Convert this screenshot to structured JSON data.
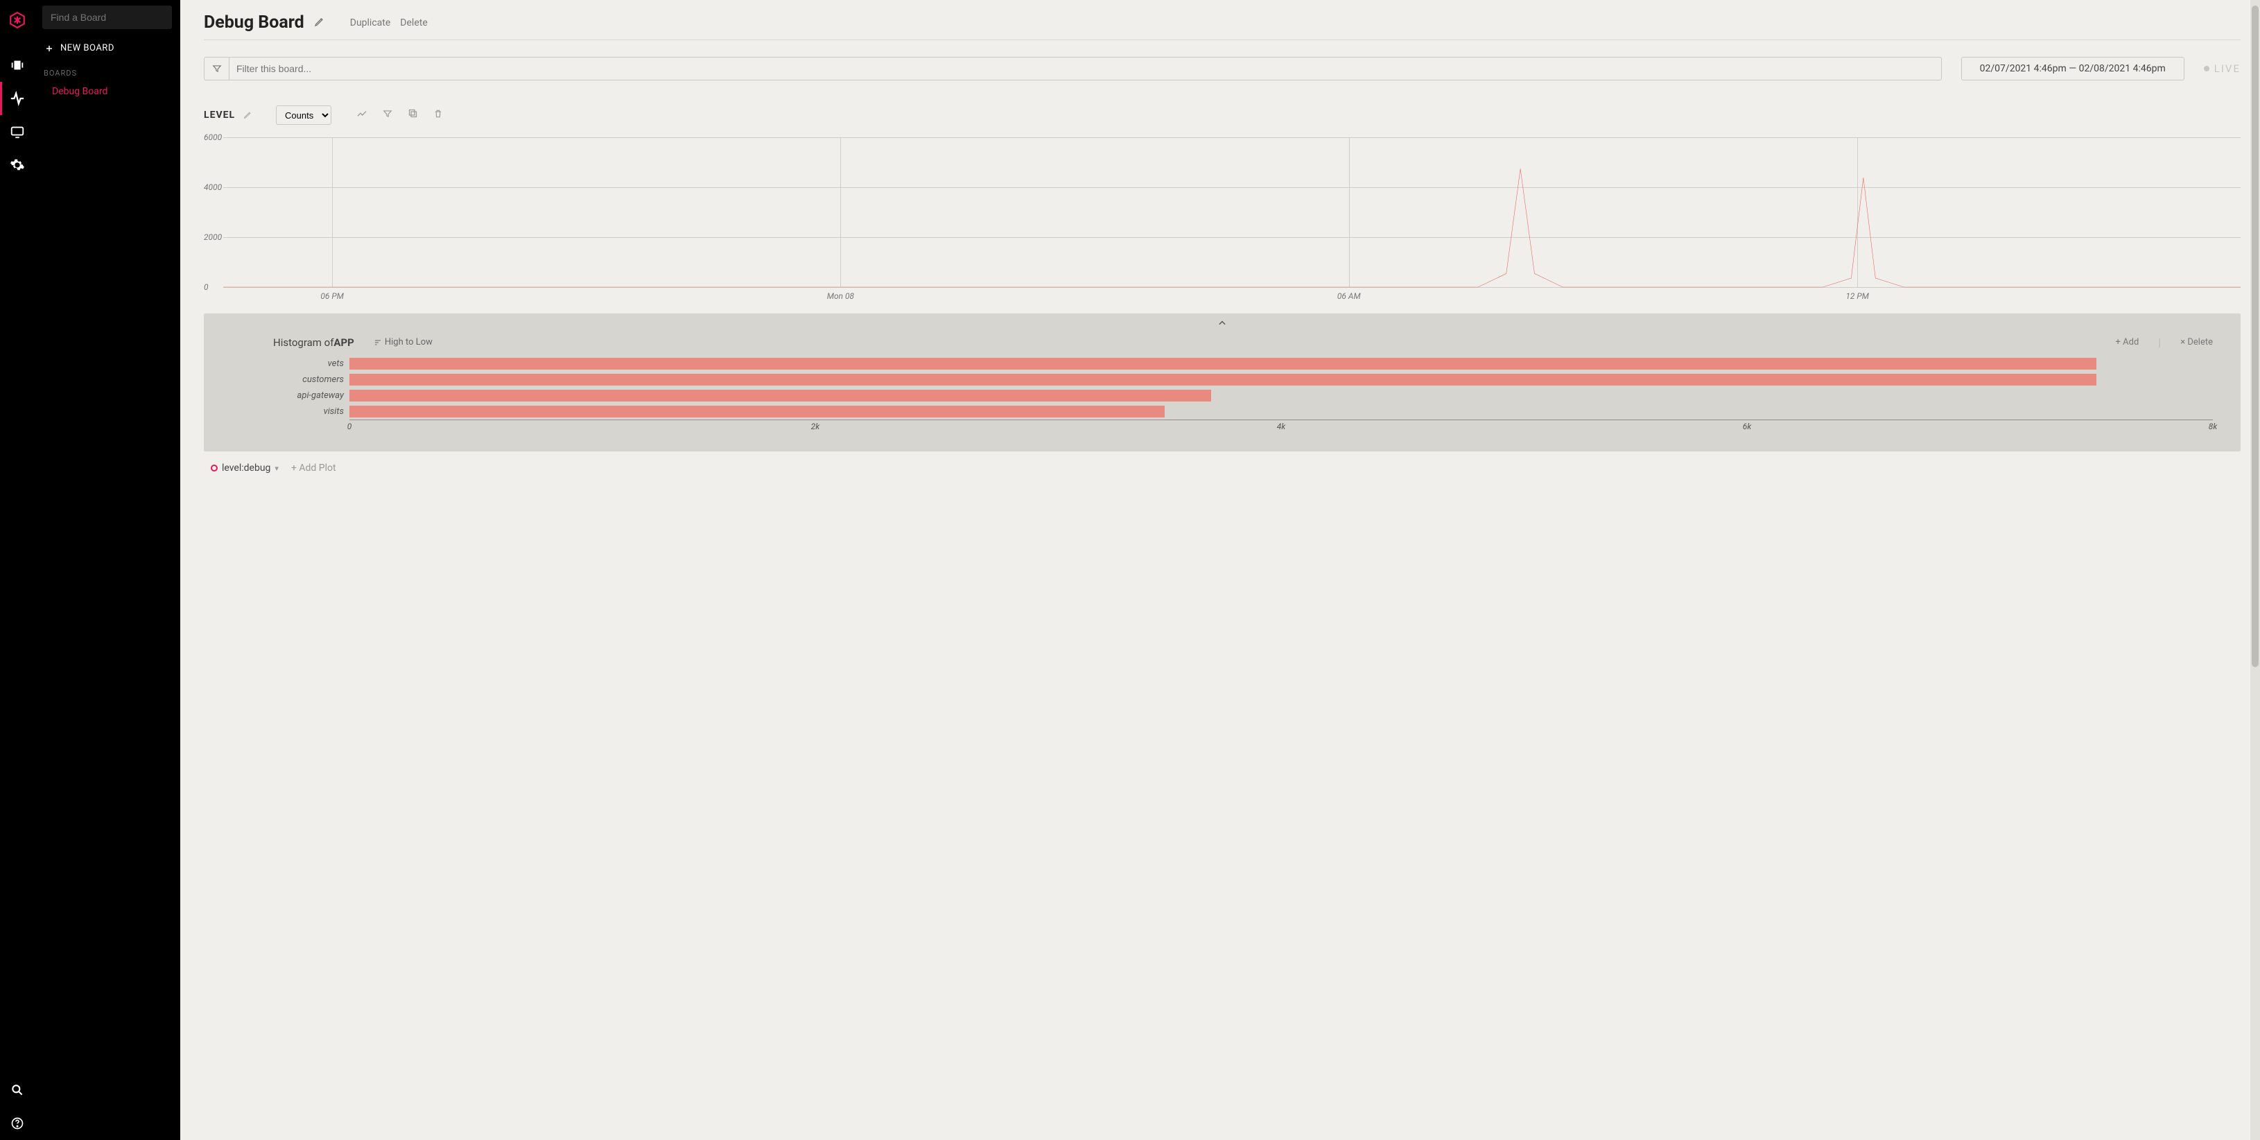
{
  "rail": {
    "items": [
      "boards",
      "activity",
      "monitor",
      "settings"
    ],
    "footer": [
      "search",
      "help"
    ]
  },
  "sidepanel": {
    "search_placeholder": "Find a Board",
    "new_board_label": "NEW BOARD",
    "section_label": "BOARDS",
    "boards": [
      {
        "name": "Debug Board",
        "active": true
      }
    ]
  },
  "header": {
    "title": "Debug Board",
    "duplicate_label": "Duplicate",
    "delete_label": "Delete"
  },
  "filter": {
    "placeholder": "Filter this board...",
    "daterange": "02/07/2021 4:46pm — 02/08/2021 4:46pm",
    "live_label": "LIVE"
  },
  "level_card": {
    "title": "LEVEL",
    "select_value": "Counts"
  },
  "chart_data": [
    {
      "type": "line",
      "title": "LEVEL",
      "ylabel": "",
      "xlabel": "",
      "ylim": [
        0,
        6000
      ],
      "y_ticks": [
        0,
        2000,
        4000,
        6000
      ],
      "x_ticks": [
        "06 PM",
        "Mon 08",
        "06 AM",
        "12 PM"
      ],
      "x_tick_positions_pct": [
        5.4,
        30.6,
        55.8,
        81.0
      ],
      "series": [
        {
          "name": "level:debug",
          "color": "#ea6a60",
          "points_pct": [
            [
              0,
              0
            ],
            [
              60.8,
              0
            ],
            [
              62.2,
              0
            ],
            [
              63.6,
              9
            ],
            [
              64.3,
              79
            ],
            [
              65.0,
              9
            ],
            [
              66.4,
              0
            ],
            [
              67.8,
              0
            ],
            [
              78.0,
              0
            ],
            [
              79.3,
              0
            ],
            [
              80.7,
              6
            ],
            [
              81.3,
              73
            ],
            [
              81.9,
              6
            ],
            [
              83.3,
              0
            ],
            [
              84.7,
              0
            ],
            [
              100,
              0
            ]
          ]
        }
      ]
    },
    {
      "type": "bar",
      "orientation": "horizontal",
      "title_prefix": "Histogram of",
      "title_bold": "APP",
      "sort_label": "High to Low",
      "add_label": "+ Add",
      "delete_label": "× Delete",
      "xlim": [
        0,
        8000
      ],
      "x_ticks": [
        0,
        2000,
        4000,
        6000,
        8000
      ],
      "x_tick_labels": [
        "0",
        "2k",
        "4k",
        "6k",
        "8k"
      ],
      "categories": [
        "vets",
        "customers",
        "api-gateway",
        "visits"
      ],
      "values": [
        7500,
        7500,
        3700,
        3500
      ],
      "color": "#e88a80"
    }
  ],
  "legend": {
    "series_label": "level:debug",
    "add_plot_label": "+ Add Plot"
  }
}
